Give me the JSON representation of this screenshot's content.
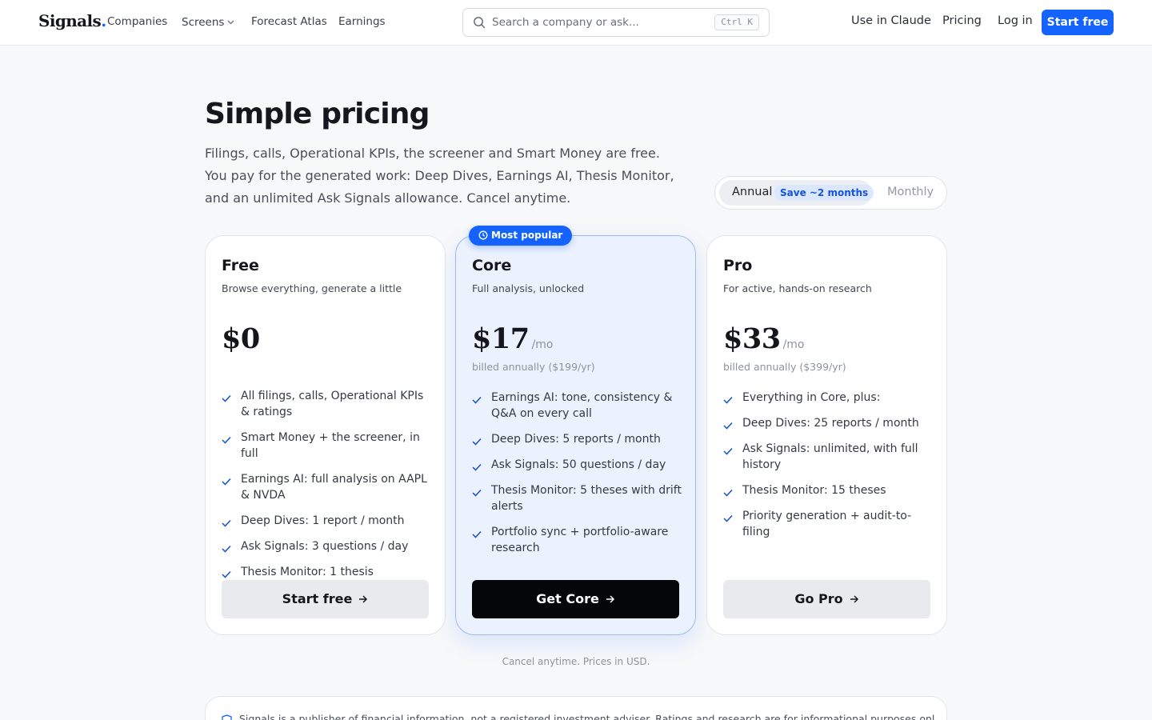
{
  "nav": {
    "logo_text": "Signals",
    "logo_dot": ".",
    "links": [
      "Companies",
      "Screens",
      "Forecast Atlas",
      "Earnings"
    ],
    "search_placeholder": "Search a company or ask...",
    "search_shortcut": "Ctrl K",
    "use_in_claude": "Use in Claude",
    "pricing": "Pricing",
    "login": "Log in",
    "start_free": "Start free"
  },
  "hero": {
    "title": "Simple pricing",
    "subtitle": "Filings, calls, Operational KPIs, the screener and Smart Money are free. You pay for the generated work: Deep Dives, Earnings AI, Thesis Monitor, and an unlimited Ask Signals allowance. Cancel anytime."
  },
  "billing_toggle": {
    "annual_label": "Annual",
    "save_badge": "Save ~2 months",
    "monthly_label": "Monthly",
    "selected": "Annual"
  },
  "plans": [
    {
      "name": "Free",
      "description": "Browse everything, generate a little",
      "price": "$0",
      "per": "",
      "billed": "",
      "features": [
        "All filings, calls, Operational KPIs & ratings",
        "Smart Money + the screener, in full",
        "Earnings AI: full analysis on AAPL & NVDA",
        "Deep Dives: 1 report / month",
        "Ask Signals: 3 questions / day",
        "Thesis Monitor: 1 thesis"
      ],
      "cta": "Start free"
    },
    {
      "name": "Core",
      "description": "Full analysis, unlocked",
      "price": "$17",
      "per": "/mo",
      "billed": "billed annually ($199/yr)",
      "badge": "Most popular",
      "features": [
        "Earnings AI: tone, consistency & Q&A on every call",
        "Deep Dives: 5 reports / month",
        "Ask Signals: 50 questions / day",
        "Thesis Monitor: 5 theses with drift alerts",
        "Portfolio sync + portfolio-aware research"
      ],
      "cta": "Get Core"
    },
    {
      "name": "Pro",
      "description": "For active, hands-on research",
      "price": "$33",
      "per": "/mo",
      "billed": "billed annually ($399/yr)",
      "features": [
        "Everything in Core, plus:",
        "Deep Dives: 25 reports / month",
        "Ask Signals: unlimited, with full history",
        "Thesis Monitor: 15 theses",
        "Priority generation + audit-to-filing"
      ],
      "cta": "Go Pro"
    }
  ],
  "footnote": "Cancel anytime. Prices in USD.",
  "disclaimer": "Signals is a publisher of financial information, not a registered investment adviser. Ratings and research are for informational purposes only and are not",
  "colors": {
    "accent": "#1463ff",
    "core_card_bg": "#ebf1fd",
    "page_bg": "#f7f8fa"
  },
  "icons": {
    "search": "search-icon",
    "chevron": "chevron-down-icon",
    "check": "check-icon",
    "arrow": "arrow-right-icon",
    "clock": "clock-icon",
    "shield": "shield-icon"
  }
}
